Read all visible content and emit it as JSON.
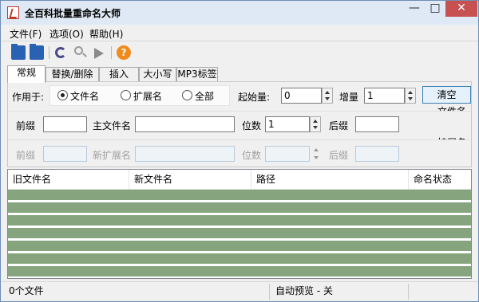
{
  "window": {
    "title": "全百科批量重命名大师",
    "controls": {
      "minimize": "—",
      "maximize": "□",
      "close": "✕"
    }
  },
  "menu": {
    "items": [
      "文件(F)",
      "选项(O)",
      "帮助(H)"
    ]
  },
  "toolbar": {
    "icons": [
      "open-folder-icon",
      "open-file-icon",
      "undo-icon",
      "search-icon",
      "play-icon",
      "help-icon"
    ],
    "help_glyph": "?"
  },
  "tabs": [
    "常规",
    "替换/删除",
    "插入",
    "大小写",
    "MP3标签"
  ],
  "apply_to": {
    "label": "作用于:",
    "options": [
      "文件名",
      "扩展名",
      "全部"
    ],
    "selected": "文件名"
  },
  "start": {
    "label": "起始量:",
    "value": "0"
  },
  "increment": {
    "label": "增量",
    "value": "1"
  },
  "clear_label": "清空",
  "filename_section": {
    "title": "文件名",
    "prefix_label": "前缀",
    "prefix_value": "",
    "main_label": "主文件名",
    "main_value": "",
    "digits_label": "位数",
    "digits_value": "1",
    "suffix_label": "后缀",
    "suffix_value": ""
  },
  "extension_section": {
    "title": "扩展名",
    "prefix_label": "前缀",
    "new_ext_label": "新扩展名",
    "digits_label": "位数",
    "suffix_label": "后缀"
  },
  "list": {
    "columns": [
      "旧文件名",
      "新文件名",
      "路径",
      "命名状态"
    ],
    "row_color": "#86a57e"
  },
  "status": {
    "file_count": "0个文件",
    "auto_preview": "自动预览 - 关"
  }
}
